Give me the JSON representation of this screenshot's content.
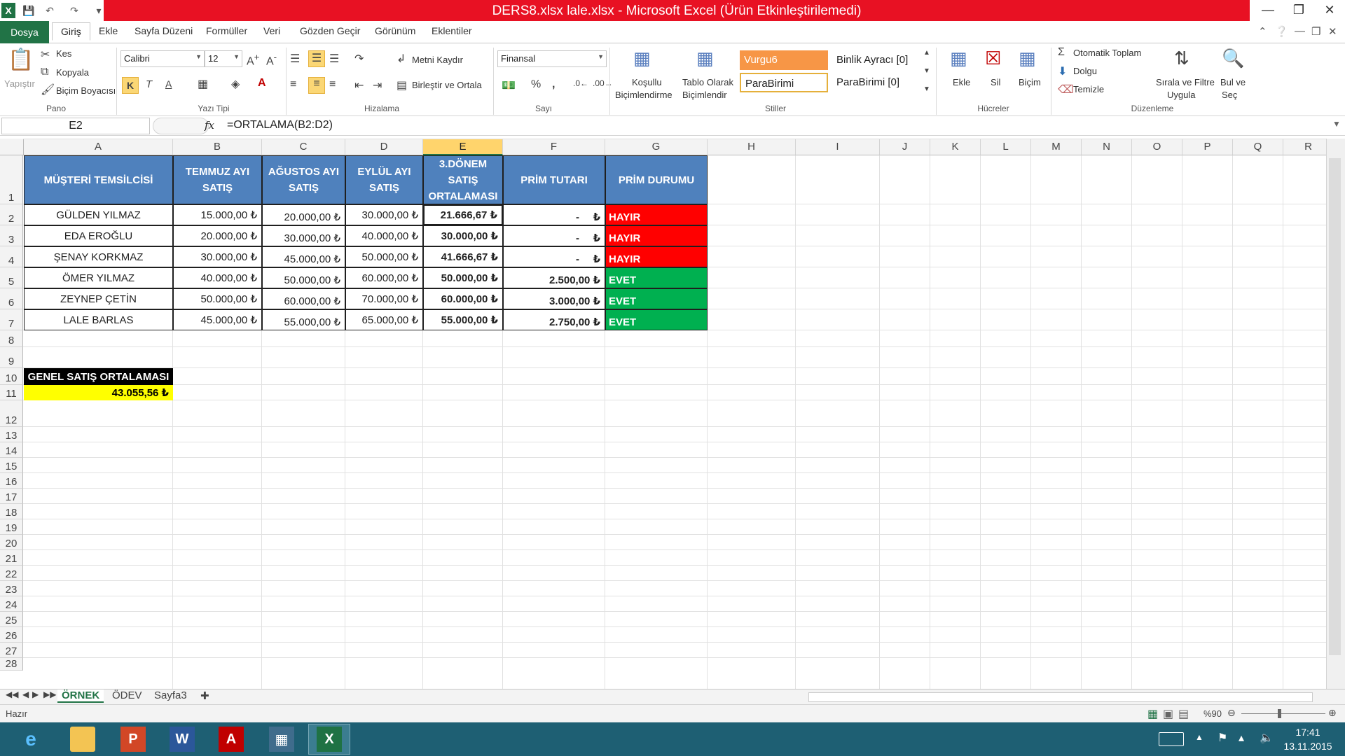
{
  "title": "DERS8.xlsx lale.xlsx  -  Microsoft Excel (Ürün Etkinleştirilemedi)",
  "menu": {
    "file": "Dosya",
    "tabs": [
      "Giriş",
      "Ekle",
      "Sayfa Düzeni",
      "Formüller",
      "Veri",
      "Gözden Geçir",
      "Görünüm",
      "Eklentiler"
    ]
  },
  "ribbon": {
    "pano": {
      "label": "Pano",
      "paste": "Yapıştır",
      "cut": "Kes",
      "copy": "Kopyala",
      "format_painter": "Biçim Boyacısı"
    },
    "font": {
      "label": "Yazı Tipi",
      "name": "Calibri",
      "size": "12",
      "bold": "K",
      "italic": "T",
      "underline": "A"
    },
    "align": {
      "label": "Hizalama",
      "wrap": "Metni Kaydır",
      "merge": "Birleştir ve Ortala"
    },
    "number": {
      "label": "Sayı",
      "format": "Finansal",
      "percent": "%",
      "comma": ","
    },
    "styles": {
      "label": "Stiller",
      "cond_l1": "Koşullu",
      "cond_l2": "Biçimlendirme",
      "table_l1": "Tablo Olarak",
      "table_l2": "Biçimlendir",
      "s1": "Vurgu6",
      "s2": "Binlik Ayracı [0]",
      "s3": "ParaBirimi",
      "s4": "ParaBirimi [0]"
    },
    "cells": {
      "label": "Hücreler",
      "insert": "Ekle",
      "delete": "Sil",
      "format": "Biçim"
    },
    "edit": {
      "label": "Düzenleme",
      "autosum": "Otomatik Toplam",
      "fill": "Dolgu",
      "clear": "Temizle",
      "sort_l1": "Sırala ve Filtre",
      "sort_l2": "Uygula",
      "find_l1": "Bul ve",
      "find_l2": "Seç"
    }
  },
  "formula_bar": {
    "name_box": "E2",
    "fx": "fx",
    "formula": "=ORTALAMA(B2:D2)"
  },
  "columns": [
    "A",
    "B",
    "C",
    "D",
    "E",
    "F",
    "G",
    "H",
    "I",
    "J",
    "K",
    "L",
    "M",
    "N",
    "O",
    "P",
    "Q",
    "R"
  ],
  "rows": [
    "1",
    "2",
    "3",
    "4",
    "5",
    "6",
    "7",
    "8",
    "9",
    "10",
    "11",
    "12",
    "13",
    "14",
    "15",
    "16",
    "17",
    "18",
    "19",
    "20",
    "21",
    "22",
    "23",
    "24",
    "25",
    "26",
    "27",
    "28"
  ],
  "table": {
    "headers": [
      "MÜŞTERİ TEMSİLCİSİ",
      "TEMMUZ AYI SATIŞ",
      "AĞUSTOS AYI SATIŞ",
      "EYLÜL AYI SATIŞ",
      "3.DÖNEM SATIŞ ORTALAMASI",
      "PRİM TUTARI",
      "PRİM DURUMU"
    ],
    "rows": [
      {
        "name": "GÜLDEN YILMAZ",
        "b": "15.000,00 ₺",
        "c": "20.000,00 ₺",
        "d": "30.000,00 ₺",
        "e": "21.666,67 ₺",
        "f_dash": "-",
        "f": "₺",
        "g": "HAYIR"
      },
      {
        "name": "EDA EROĞLU",
        "b": "20.000,00 ₺",
        "c": "30.000,00 ₺",
        "d": "40.000,00 ₺",
        "e": "30.000,00 ₺",
        "f_dash": "-",
        "f": "₺",
        "g": "HAYIR"
      },
      {
        "name": "ŞENAY KORKMAZ",
        "b": "30.000,00 ₺",
        "c": "45.000,00 ₺",
        "d": "50.000,00 ₺",
        "e": "41.666,67 ₺",
        "f_dash": "-",
        "f": "₺",
        "g": "HAYIR"
      },
      {
        "name": "ÖMER YILMAZ",
        "b": "40.000,00 ₺",
        "c": "50.000,00 ₺",
        "d": "60.000,00 ₺",
        "e": "50.000,00 ₺",
        "f_dash": "",
        "f": "2.500,00 ₺",
        "g": "EVET"
      },
      {
        "name": "ZEYNEP ÇETİN",
        "b": "50.000,00 ₺",
        "c": "60.000,00 ₺",
        "d": "70.000,00 ₺",
        "e": "60.000,00 ₺",
        "f_dash": "",
        "f": "3.000,00 ₺",
        "g": "EVET"
      },
      {
        "name": "LALE BARLAS",
        "b": "45.000,00 ₺",
        "c": "55.000,00 ₺",
        "d": "65.000,00 ₺",
        "e": "55.000,00 ₺",
        "f_dash": "",
        "f": "2.750,00 ₺",
        "g": "EVET"
      }
    ]
  },
  "summary": {
    "label": "GENEL SATIŞ ORTALAMASI",
    "value": "43.055,56 ₺"
  },
  "sheets": [
    "ÖRNEK",
    "ÖDEV",
    "Sayfa3"
  ],
  "status": {
    "ready": "Hazır",
    "zoom": "%90"
  },
  "clock": {
    "time": "17:41",
    "date": "13.11.2015"
  },
  "colors": {
    "accent": "#217346",
    "header_fill": "#4f81bd",
    "no": "#ff0000",
    "yes": "#00b050",
    "title_bar": "#e81123"
  }
}
